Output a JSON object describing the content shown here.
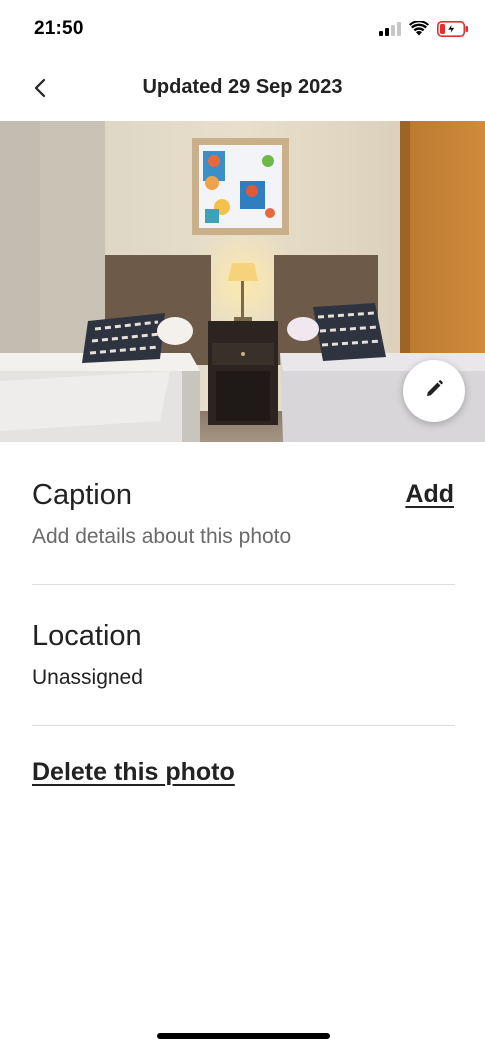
{
  "status_bar": {
    "time": "21:50",
    "icons": [
      "signal-icon",
      "wifi-icon",
      "battery-charging-icon"
    ]
  },
  "header": {
    "back_icon": "chevron-left-icon",
    "title": "Updated 29 Sep 2023"
  },
  "photo": {
    "description_icon": "bedroom-photo",
    "edit_icon": "pencil-icon"
  },
  "caption": {
    "title": "Caption",
    "add_label": "Add",
    "placeholder": "Add details about this photo"
  },
  "location": {
    "title": "Location",
    "value": "Unassigned"
  },
  "actions": {
    "delete_label": "Delete this photo"
  },
  "colors": {
    "text": "#222222",
    "muted": "#6a6a6a",
    "divider": "#dddddd",
    "background": "#ffffff"
  }
}
